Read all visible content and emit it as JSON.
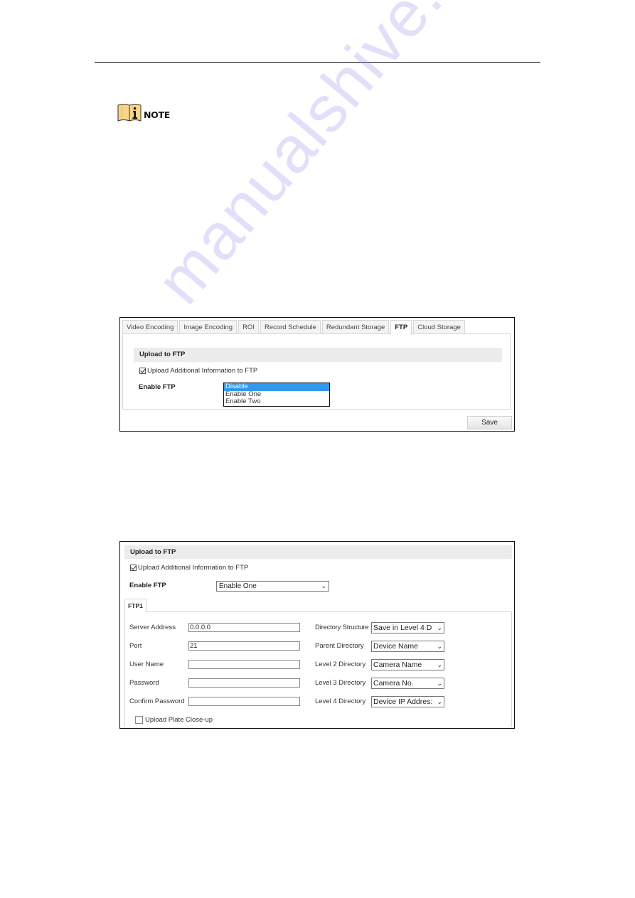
{
  "note": {
    "icon": "info-book-icon",
    "label": "NOTE"
  },
  "screenshot1": {
    "tabs": [
      {
        "label": "Video Encoding",
        "active": false
      },
      {
        "label": "Image Encoding",
        "active": false
      },
      {
        "label": "ROI",
        "active": false
      },
      {
        "label": "Record Schedule",
        "active": false
      },
      {
        "label": "Redundant Storage",
        "active": false
      },
      {
        "label": "FTP",
        "active": true
      },
      {
        "label": "Cloud Storage",
        "active": false
      }
    ],
    "section_title": "Upload to FTP",
    "upload_info_checkbox": {
      "label": "Upload Additional Information to FTP",
      "checked": true
    },
    "enable_ftp_label": "Enable FTP",
    "enable_ftp_options": [
      {
        "label": "Disable",
        "selected": true
      },
      {
        "label": "Enable One",
        "selected": false
      },
      {
        "label": "Enable Two",
        "selected": false
      }
    ],
    "save_label": "Save",
    "selection_color": "#3399ee"
  },
  "screenshot2": {
    "section_title": "Upload to FTP",
    "upload_info_checkbox": {
      "label": "Upload Additional Information to FTP",
      "checked": true
    },
    "enable_ftp_label": "Enable FTP",
    "enable_ftp_value": "Enable One",
    "ftp_tab": "FTP1",
    "fields": [
      {
        "label": "Server Address",
        "value": "0.0.0.0"
      },
      {
        "label": "Port",
        "value": "21"
      },
      {
        "label": "User Name",
        "value": ""
      },
      {
        "label": "Password",
        "value": ""
      },
      {
        "label": "Confirm Password",
        "value": ""
      }
    ],
    "directories": [
      {
        "label": "Directory Structure",
        "value": "Save in Level 4 D"
      },
      {
        "label": "Parent Directory",
        "value": "Device Name"
      },
      {
        "label": "Level 2 Directory",
        "value": "Camera Name"
      },
      {
        "label": "Level 3 Directory",
        "value": "Camera No."
      },
      {
        "label": "Level 4 Directory",
        "value": "Device IP Addres:"
      }
    ],
    "plate_checkbox": {
      "label": "Upload Plate Close-up",
      "checked": false
    }
  },
  "watermark": "manualshive.com",
  "chevron": "⌵"
}
